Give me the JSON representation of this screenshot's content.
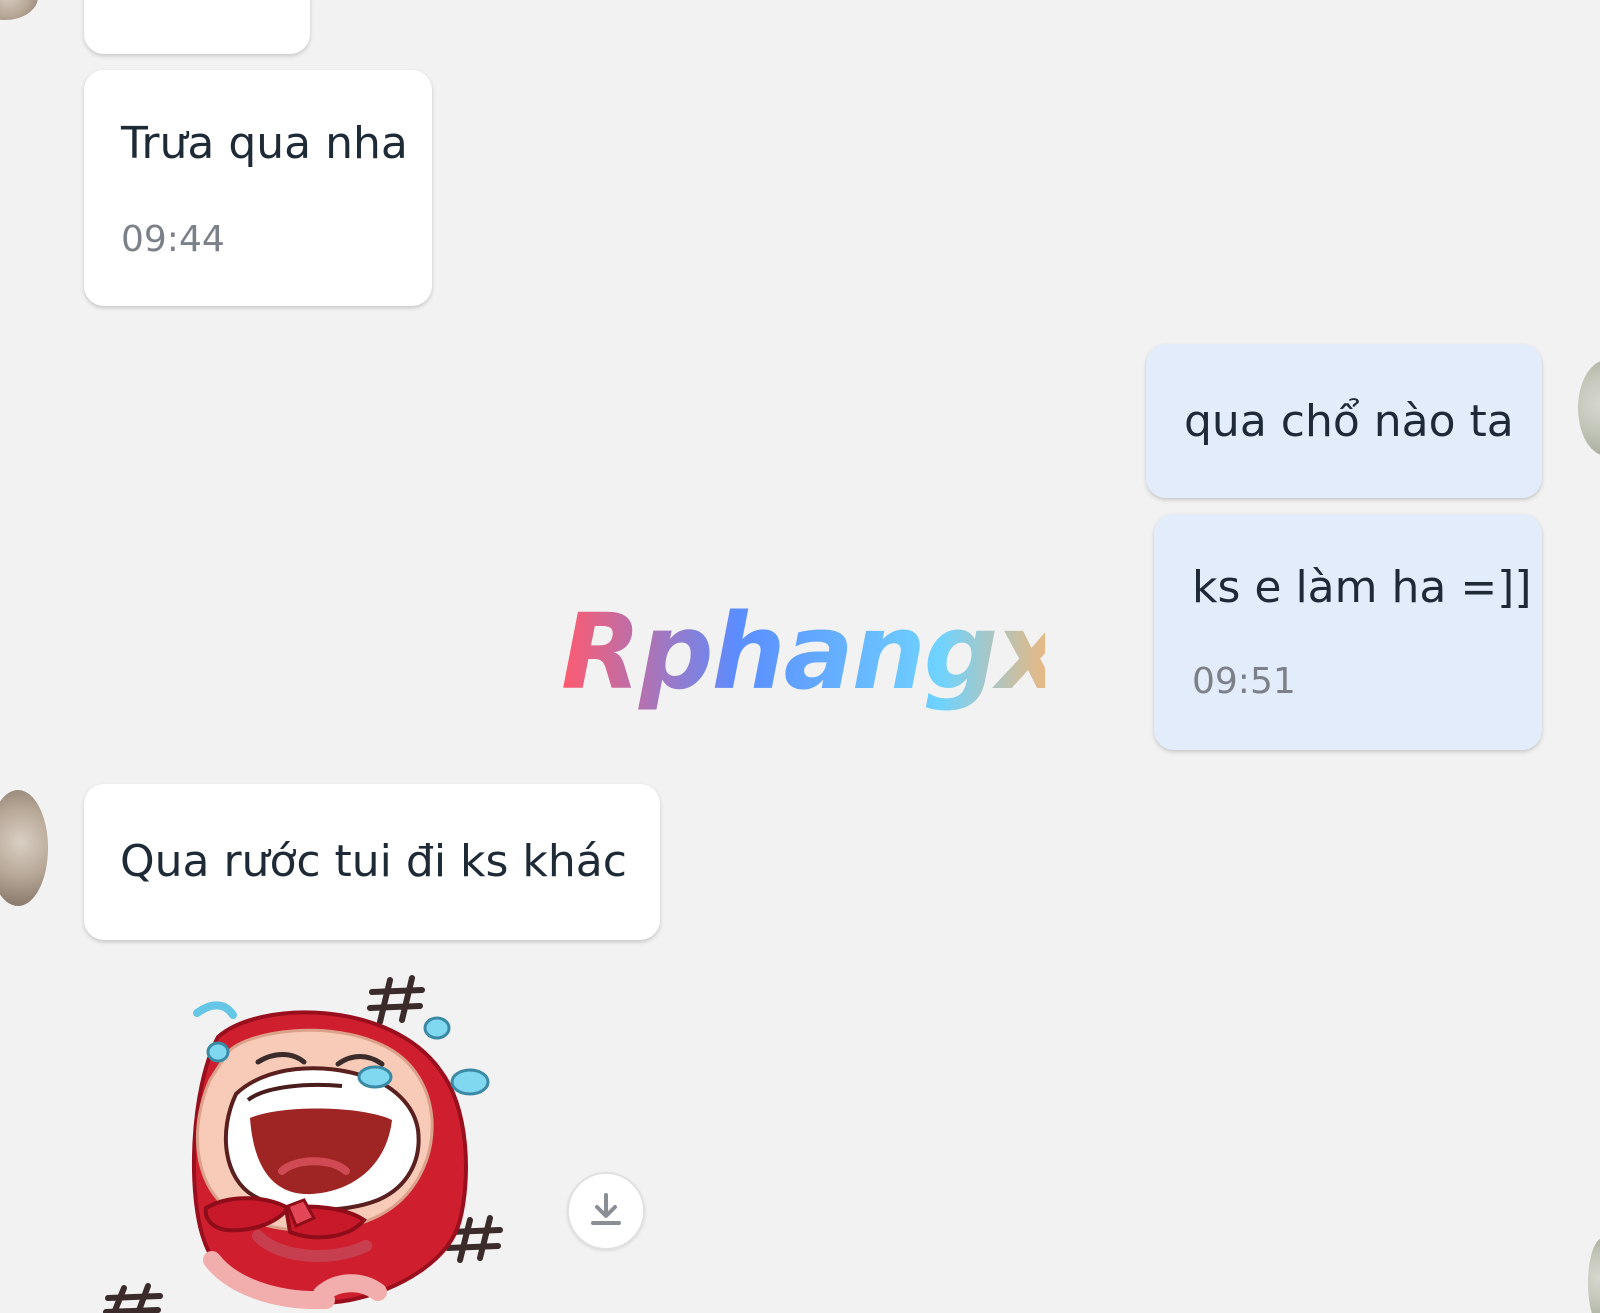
{
  "watermark": {
    "text": "Rphangx",
    "colors": [
      "#ff5a6e",
      "#5b8dff",
      "#6fd3ff",
      "#ffb36b"
    ]
  },
  "messages": [
    {
      "direction": "incoming",
      "text": "Trưa qua nha",
      "time": "09:44"
    },
    {
      "direction": "outgoing",
      "text": "qua chổ nào ta",
      "time": ""
    },
    {
      "direction": "outgoing",
      "text": "ks e làm ha =]]",
      "time": "09:51"
    },
    {
      "direction": "incoming",
      "text": "Qua rước tui đi ks khác",
      "time": ""
    }
  ],
  "sticker": {
    "name": "crying-laughing-red-hood-sticker"
  },
  "actions": {
    "download_icon": "download-icon"
  }
}
